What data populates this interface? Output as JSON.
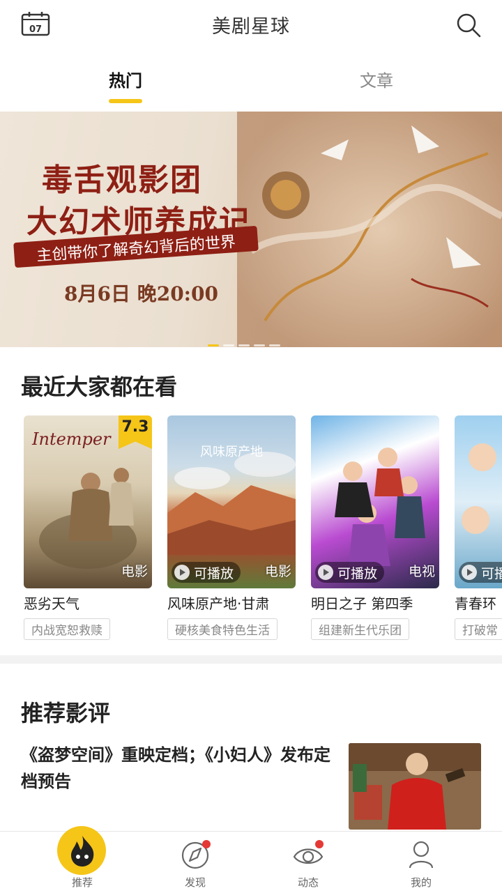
{
  "header": {
    "calendar_day": "07",
    "title": "美剧星球"
  },
  "tabs": [
    {
      "label": "热门",
      "active": true
    },
    {
      "label": "文章",
      "active": false
    }
  ],
  "banner": {
    "title_line1": "毒舌观影团",
    "title_line2": "大幻术师养成记",
    "ribbon": "主创带你了解奇幻背后的世界",
    "date": "8月6日 晚20:00"
  },
  "watching": {
    "section_title": "最近大家都在看",
    "cards": [
      {
        "title": "恶劣天气",
        "tag": "内战宽恕救赎",
        "type": "电影",
        "score": "7.3",
        "poster_text": "Intemper",
        "playable": false
      },
      {
        "title": "风味原产地·甘肃",
        "tag": "硬核美食特色生活",
        "type": "电影",
        "playable": true,
        "playable_label": "可播放",
        "poster_text": "风味原产地"
      },
      {
        "title": "明日之子 第四季",
        "tag": "组建新生代乐团",
        "type": "电视",
        "playable": true,
        "playable_label": "可播放"
      },
      {
        "title": "青春环",
        "tag": "打破常",
        "type": "",
        "playable": true,
        "playable_label": "可播"
      }
    ]
  },
  "reviews": {
    "section_title": "推荐影评",
    "item_title": "《盗梦空间》重映定档；《小妇人》发布定档预告"
  },
  "bottom_nav": [
    {
      "label": "推荐",
      "icon": "flame-icon"
    },
    {
      "label": "发现",
      "icon": "compass-icon"
    },
    {
      "label": "动态",
      "icon": "eye-icon"
    },
    {
      "label": "我的",
      "icon": "user-icon"
    }
  ],
  "colors": {
    "accent": "#f5c518",
    "banner_red": "#8e1f14",
    "notify": "#e53935"
  }
}
